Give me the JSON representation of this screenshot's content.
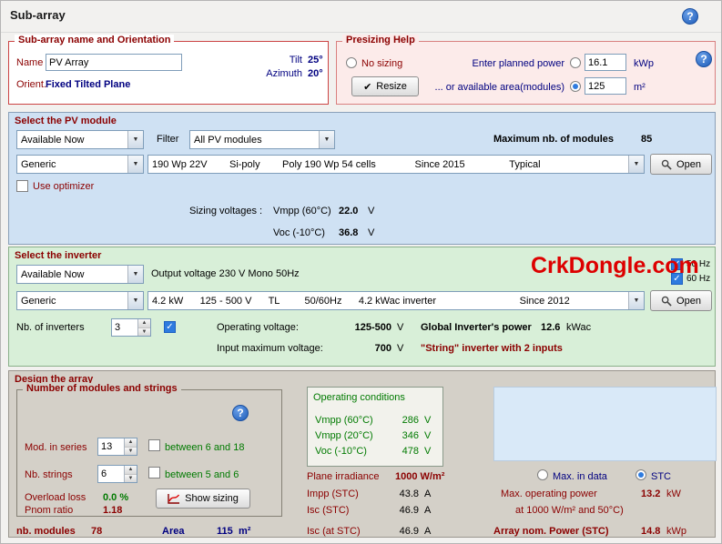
{
  "icons": {
    "help": "?",
    "check": "✓",
    "dropdown_arrow": "▼",
    "up_arrow": "▲",
    "down_arrow": "▼",
    "resize_check": "✔"
  },
  "header": {
    "title": "Sub-array"
  },
  "orientation": {
    "legend": "Sub-array name and Orientation",
    "name_label": "Name",
    "name_value": "PV Array",
    "orient_label": "Orient.",
    "orient_value": "Fixed Tilted Plane",
    "tilt_label": "Tilt",
    "tilt_value": "25°",
    "azimuth_label": "Azimuth",
    "azimuth_value": "20°"
  },
  "presizing": {
    "legend": "Presizing Help",
    "no_sizing_label": "No sizing",
    "planned_power_label": "Enter planned power",
    "planned_power_value": "16.1",
    "planned_power_unit": "kWp",
    "resize_label": "Resize",
    "area_label": "... or available area(modules)",
    "area_value": "125",
    "area_unit": "m²"
  },
  "pv_module": {
    "legend": "Select the PV module",
    "availability_value": "Available Now",
    "filter_label": "Filter",
    "filter_value": "All PV modules",
    "max_modules_label": "Maximum nb. of modules",
    "max_modules_value": "85",
    "manufacturer_value": "Generic",
    "model_value": "190 Wp 22V        Si-poly        Poly 190 Wp 54 cells              Since 2015                Typical",
    "open_label": "Open",
    "use_optimizer_label": "Use optimizer",
    "sizing_label": "Sizing voltages :",
    "vmpp_label": "Vmpp (60°C)",
    "vmpp_value": "22.0",
    "vmpp_unit": "V",
    "voc_label": "Voc (-10°C)",
    "voc_value": "36.8",
    "voc_unit": "V"
  },
  "inverter": {
    "legend": "Select the inverter",
    "availability_value": "Available Now",
    "output_voltage": "Output voltage 230 V Mono 50Hz",
    "watermark": "CrkDongle.com",
    "freq_50_label": "50 Hz",
    "freq_60_label": "60 Hz",
    "manufacturer_value": "Generic",
    "model_value": "4.2 kW      125 - 500 V      TL         50/60Hz      4.2 kWac inverter                              Since 2012",
    "open_label": "Open",
    "nb_inverters_label": "Nb. of inverters",
    "nb_inverters_value": "3",
    "operating_voltage_label": "Operating voltage:",
    "operating_voltage_value": "125-500",
    "operating_voltage_unit": "V",
    "global_power_label": "Global Inverter's power",
    "global_power_value": "12.6",
    "global_power_unit": "kWac",
    "input_max_label": "Input maximum voltage:",
    "input_max_value": "700",
    "input_max_unit": "V",
    "string_note": "\"String\" inverter with 2 inputs"
  },
  "design": {
    "legend": "Design the array",
    "group": {
      "legend": "Number of modules and strings",
      "mod_series_label": "Mod. in series",
      "mod_series_value": "13",
      "mod_series_hint": "between 6 and 18",
      "nb_strings_label": "Nb. strings",
      "nb_strings_value": "6",
      "nb_strings_hint": "between 5 and 6",
      "overload_label": "Overload loss",
      "overload_value": "0.0 %",
      "pnom_label": "Pnom ratio",
      "pnom_value": "1.18",
      "show_sizing_label": "Show sizing"
    },
    "totals": {
      "nb_modules_label": "nb. modules",
      "nb_modules_value": "78",
      "area_label": "Area",
      "area_value": "115",
      "area_unit": "m²"
    },
    "operating_conditions": {
      "title": "Operating conditions",
      "rows": [
        {
          "label": "Vmpp (60°C)",
          "value": "286",
          "unit": "V"
        },
        {
          "label": "Vmpp (20°C)",
          "value": "346",
          "unit": "V"
        },
        {
          "label": "Voc (-10°C)",
          "value": "478",
          "unit": "V"
        }
      ]
    },
    "conditions": {
      "plane_label": "Plane irradiance",
      "plane_value": "1000 W/m²",
      "impp_label": "Impp (STC)",
      "impp_value": "43.8",
      "impp_unit": "A",
      "isc_label": "Isc (STC)",
      "isc_value": "46.9",
      "isc_unit": "A",
      "isc_at_label": "Isc (at STC)",
      "isc_at_value": "46.9",
      "isc_at_unit": "A"
    },
    "power": {
      "max_in_data_label": "Max. in data",
      "stc_label": "STC",
      "max_power_label": "Max. operating power",
      "max_power_value": "13.2",
      "max_power_unit": "kW",
      "max_power_cond": "at 1000 W/m² and 50°C)",
      "array_power_label": "Array nom. Power (STC)",
      "array_power_value": "14.8",
      "array_power_unit": "kWp"
    }
  }
}
